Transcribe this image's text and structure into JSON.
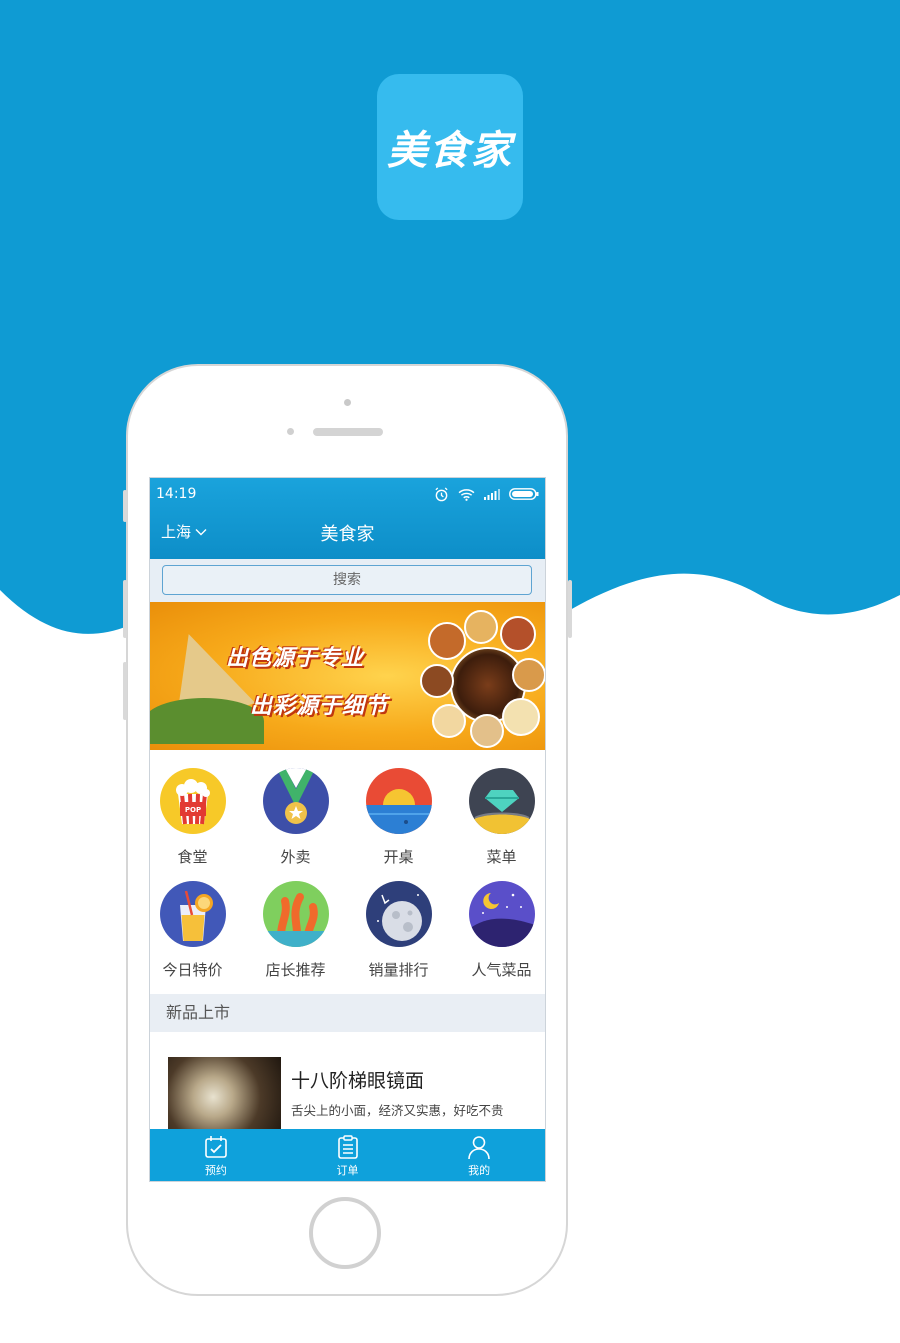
{
  "brand": {
    "logo_text": "美食家"
  },
  "status_bar": {
    "time": "14:19"
  },
  "nav": {
    "city": "上海",
    "title": "美食家"
  },
  "search": {
    "placeholder": "搜索"
  },
  "banner": {
    "line1": "出色源于专业",
    "line2": "出彩源于细节"
  },
  "categories": [
    {
      "label": "食堂",
      "icon": "popcorn-icon"
    },
    {
      "label": "外卖",
      "icon": "medal-icon"
    },
    {
      "label": "开桌",
      "icon": "sunset-icon"
    },
    {
      "label": "菜单",
      "icon": "diamond-icon"
    },
    {
      "label": "今日特价",
      "icon": "juice-icon"
    },
    {
      "label": "店长推荐",
      "icon": "octopus-icon"
    },
    {
      "label": "销量排行",
      "icon": "moon-icon"
    },
    {
      "label": "人气菜品",
      "icon": "night-sky-icon"
    }
  ],
  "section": {
    "title": "新品上市"
  },
  "product": {
    "name": "十八阶梯眼镜面",
    "description": "舌尖上的小面，经济又实惠，好吃不贵"
  },
  "tabs": [
    {
      "label": "预约",
      "icon": "calendar-check-icon"
    },
    {
      "label": "订单",
      "icon": "clipboard-icon"
    },
    {
      "label": "我的",
      "icon": "user-icon"
    }
  ],
  "colors": {
    "brand_blue": "#0f9bd3",
    "logo_blue": "#36bbee",
    "tabbar": "#0fa1db"
  }
}
